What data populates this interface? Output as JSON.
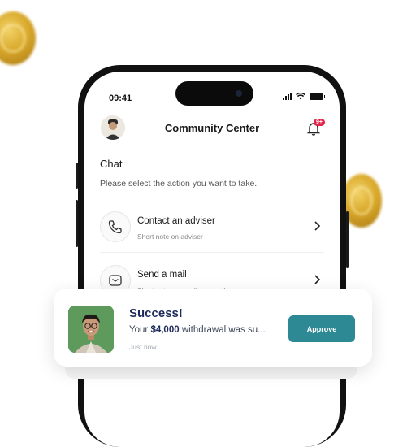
{
  "status_bar": {
    "time": "09:41"
  },
  "header": {
    "title": "Community Center",
    "notification_badge": "9+"
  },
  "section": {
    "title": "Chat",
    "subtitle": "Please select the action you want to take."
  },
  "actions": [
    {
      "label": "Contact an adviser",
      "note": "Short note on adviser",
      "icon": "phone-icon"
    },
    {
      "label": "Send a mail",
      "note": "Short note on sending a mail",
      "icon": "mail-icon"
    }
  ],
  "toast": {
    "title": "Success!",
    "msg_prefix": "Your ",
    "amount": "$4,000",
    "msg_suffix": " withdrawal was su...",
    "time": "Just now",
    "approve_label": "Approve"
  },
  "colors": {
    "accent": "#2d8a94",
    "badge": "#e4244a",
    "title": "#1d2b5a"
  }
}
